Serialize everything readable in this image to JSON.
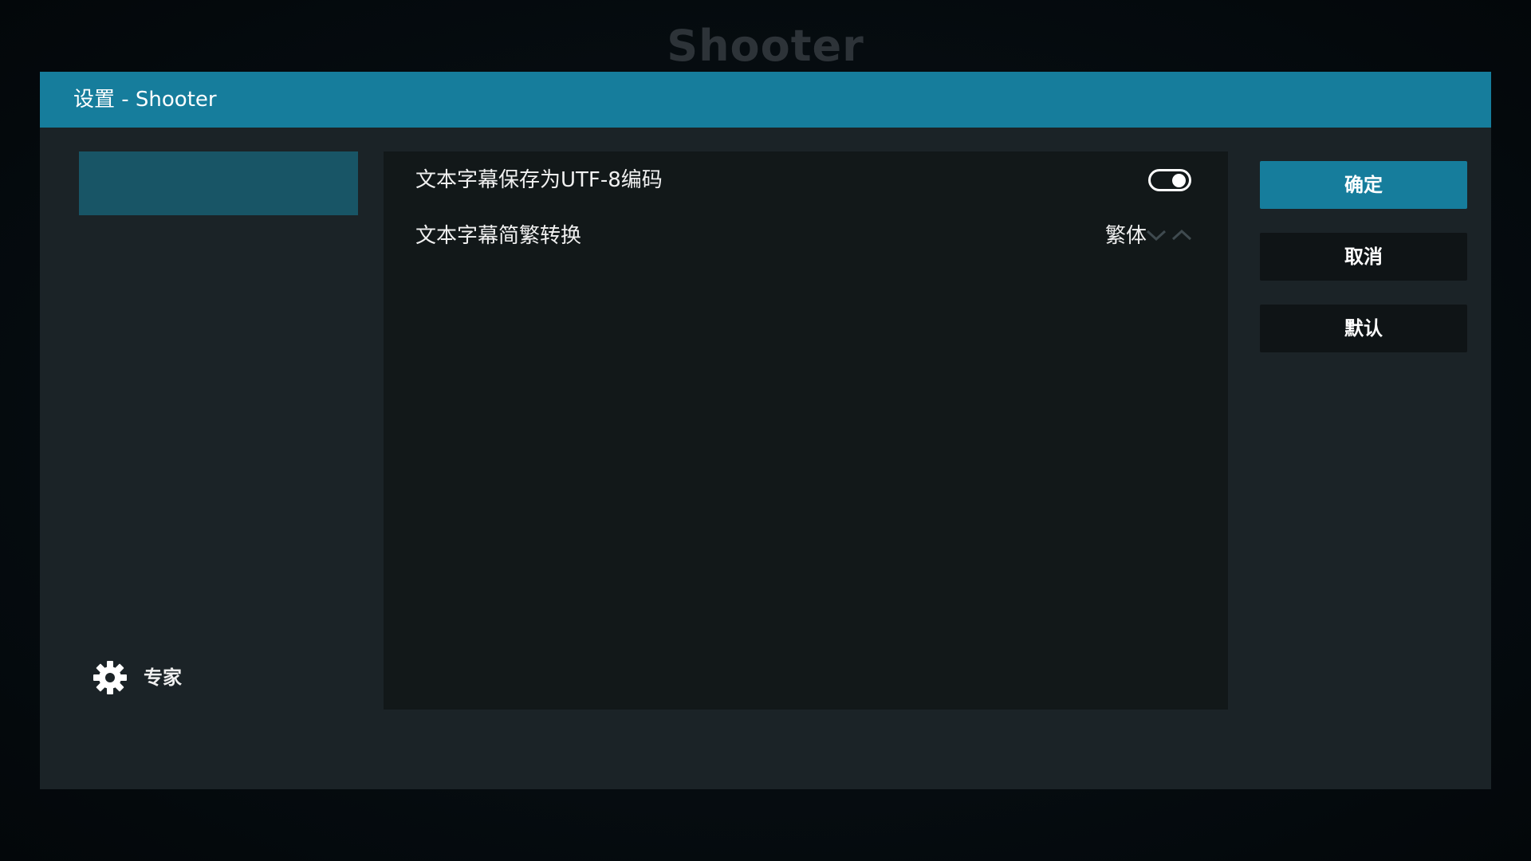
{
  "background": {
    "addon_name": "Shooter"
  },
  "dialog": {
    "title": "设置 - Shooter",
    "accent_color": "#167d9c"
  },
  "settings": [
    {
      "label": "文本字幕保存为UTF-8编码",
      "type": "toggle",
      "enabled": true
    },
    {
      "label": "文本字幕简繁转换",
      "type": "spinner",
      "value": "繁体"
    }
  ],
  "buttons": {
    "ok": "确定",
    "cancel": "取消",
    "default": "默认"
  },
  "settings_level": {
    "icon": "gear-icon",
    "label": "专家"
  }
}
